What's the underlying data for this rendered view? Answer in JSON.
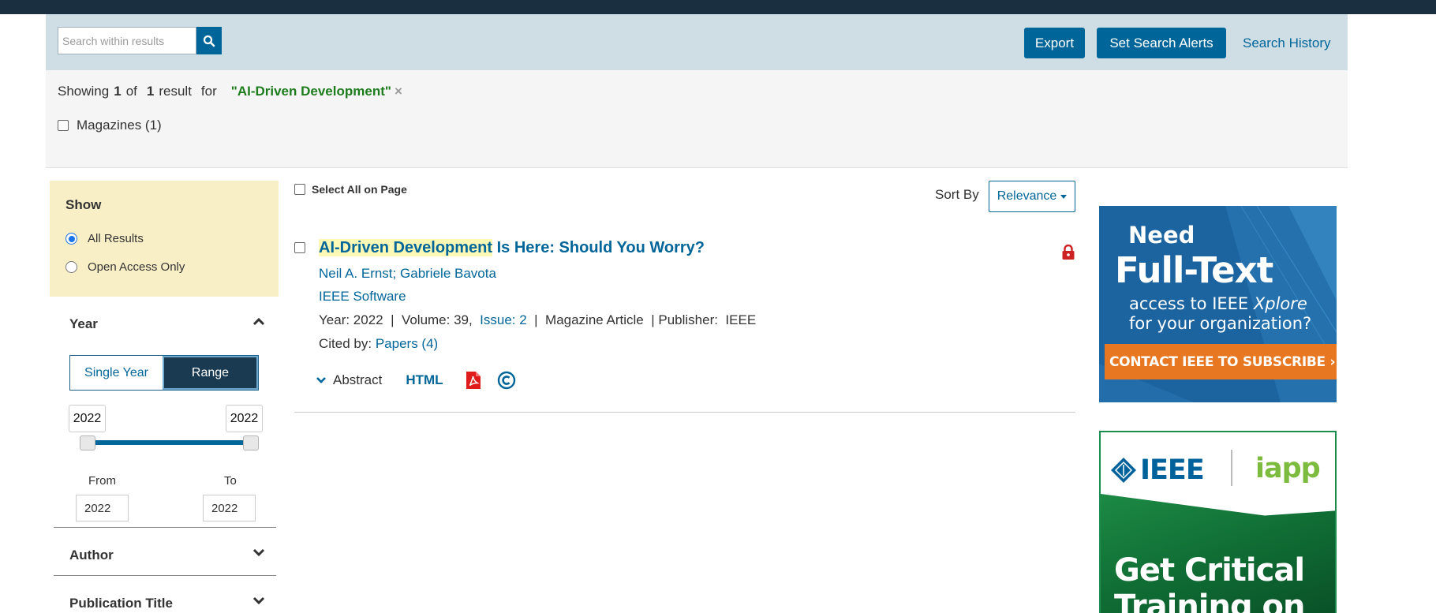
{
  "toolbar": {
    "search_placeholder": "Search within results",
    "export_label": "Export",
    "alerts_label": "Set Search Alerts",
    "history_label": "Search History"
  },
  "summary": {
    "showing_prefix": "Showing",
    "shown_count": "1",
    "of_label": "of",
    "total_count": "1",
    "result_label": "result",
    "for_label": "for",
    "query": "\"AI-Driven Development\"",
    "clear_glyph": "×",
    "facet_chip": "Magazines (1)"
  },
  "sidebar": {
    "show_title": "Show",
    "show_options": [
      {
        "label": "All Results",
        "selected": true
      },
      {
        "label": "Open Access Only",
        "selected": false
      }
    ],
    "year": {
      "title": "Year",
      "mode_single": "Single Year",
      "mode_range": "Range",
      "active_mode": "Range",
      "slider_min": "2022",
      "slider_max": "2022",
      "from_label": "From",
      "to_label": "To",
      "from_value": "2022",
      "to_value": "2022"
    },
    "author_title": "Author",
    "publication_title": "Publication Title"
  },
  "results": {
    "select_all_label": "Select All on Page",
    "sort_label": "Sort By",
    "sort_value": "Relevance",
    "items": [
      {
        "title_highlight": "AI-Driven Development",
        "title_rest": " Is Here: Should You Worry?",
        "authors": [
          "Neil A. Ernst",
          "Gabriele Bavota"
        ],
        "author_sep": ";",
        "publication": "IEEE Software",
        "year_text": "Year: 2022",
        "volume_text": "Volume: 39,",
        "issue_text": "Issue: 2",
        "type_text": "Magazine Article",
        "publisher_label": "Publisher:",
        "publisher_value": "IEEE",
        "cited_label": "Cited by:",
        "cited_link": "Papers (4)",
        "abstract_label": "Abstract",
        "html_label": "HTML",
        "access": "locked"
      }
    ]
  },
  "ads": {
    "ad1": {
      "line_need": "Need",
      "line_full": "Full-Text",
      "line_access_prefix": "access to IEEE ",
      "line_access_brand": "Xplore",
      "line_org": "for your organization?",
      "cta": "CONTACT IEEE TO SUBSCRIBE ›"
    },
    "ad2": {
      "logo_left": "IEEE",
      "logo_right": "iapp",
      "headline_1": "Get Critical",
      "headline_2": "Training on"
    }
  },
  "colors": {
    "primary": "#006699",
    "topbar": "#1a2f3f",
    "toolbar_bg": "#cfdde5",
    "query_green": "#1d7d1d",
    "show_panel": "#f8efc7",
    "lock_red": "#cc2222",
    "ad_orange": "#e87722"
  },
  "icons": {
    "search": "search-icon",
    "chevron_up": "chevron-up-icon",
    "chevron_down": "chevron-down-icon",
    "lock": "lock-icon",
    "pdf": "pdf-icon",
    "copyright": "copyright-icon"
  }
}
